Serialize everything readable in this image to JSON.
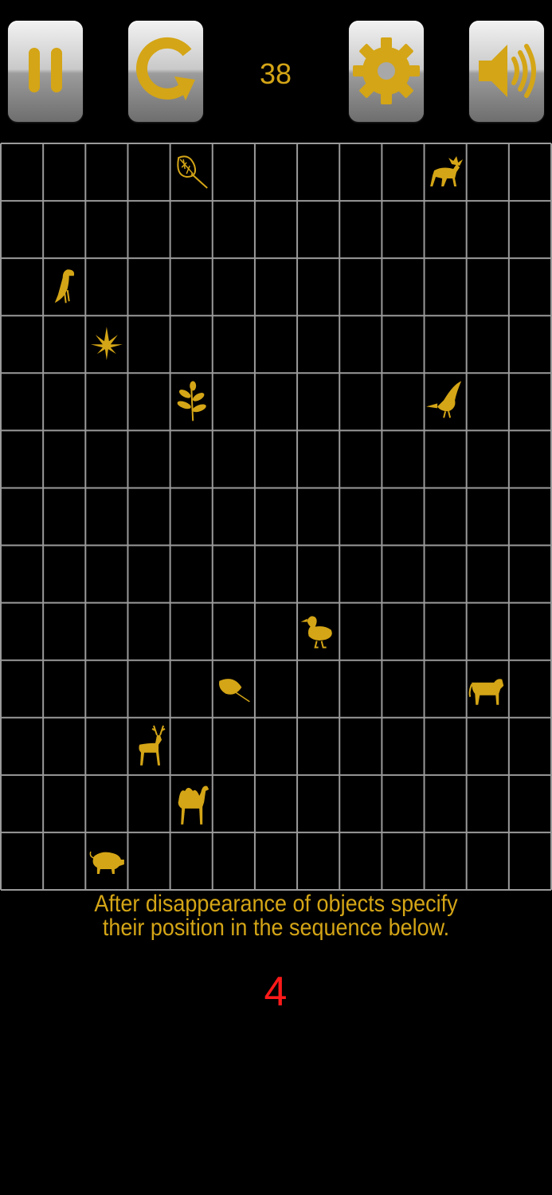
{
  "toolbar": {
    "buttons": [
      {
        "name": "pause-button",
        "icon": "pause-icon"
      },
      {
        "name": "restart-button",
        "icon": "restart-icon"
      },
      {
        "name": "settings-button",
        "icon": "gear-icon"
      },
      {
        "name": "sound-button",
        "icon": "speaker-icon"
      }
    ],
    "counter": "38"
  },
  "colors": {
    "background": "#000000",
    "accent": "#d4a516",
    "grid_lines": "#9a9a9a",
    "answer": "#ff1a1a"
  },
  "board": {
    "columns": 13,
    "rows": 13,
    "objects": [
      {
        "icon": "leaf-icon",
        "row": 0,
        "col": 4
      },
      {
        "icon": "moose-icon",
        "row": 0,
        "col": 10
      },
      {
        "icon": "vulture-icon",
        "row": 2,
        "col": 1
      },
      {
        "icon": "cannabis-leaf-icon",
        "row": 3,
        "col": 2
      },
      {
        "icon": "plant-sprig-icon",
        "row": 4,
        "col": 4
      },
      {
        "icon": "pelican-icon",
        "row": 4,
        "col": 10
      },
      {
        "icon": "duck-icon",
        "row": 8,
        "col": 7
      },
      {
        "icon": "birch-leaf-icon",
        "row": 9,
        "col": 5
      },
      {
        "icon": "cow-icon",
        "row": 9,
        "col": 11
      },
      {
        "icon": "deer-icon",
        "row": 10,
        "col": 3
      },
      {
        "icon": "camel-icon",
        "row": 11,
        "col": 4
      },
      {
        "icon": "pig-icon",
        "row": 12,
        "col": 2
      }
    ]
  },
  "instructions": {
    "line1": "After disappearance of objects specify",
    "line2": "their position in the sequence below."
  },
  "answer": {
    "value": "4"
  }
}
